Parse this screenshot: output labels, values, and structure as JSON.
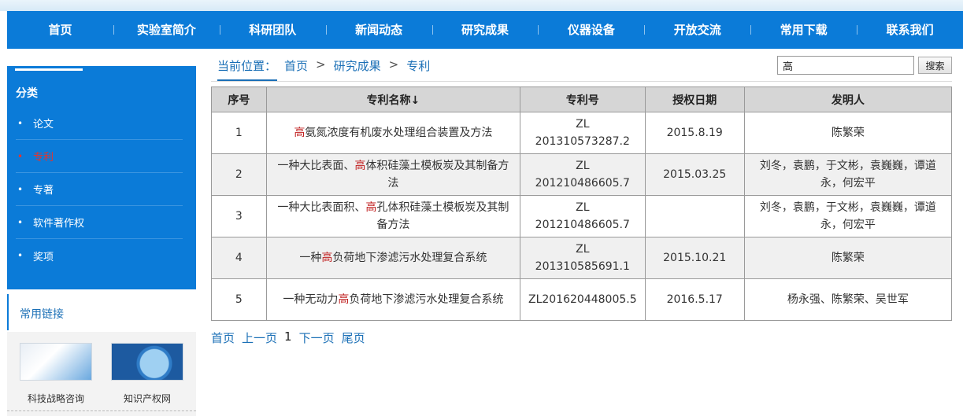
{
  "nav": [
    "首页",
    "实验室简介",
    "科研团队",
    "新闻动态",
    "研究成果",
    "仪器设备",
    "开放交流",
    "常用下载",
    "联系我们"
  ],
  "sidebar": {
    "title": "分类",
    "items": [
      {
        "label": "论文",
        "active": false
      },
      {
        "label": "专利",
        "active": true
      },
      {
        "label": "专著",
        "active": false
      },
      {
        "label": "软件著作权",
        "active": false
      },
      {
        "label": "奖项",
        "active": false
      }
    ]
  },
  "links": {
    "title": "常用链接",
    "items": [
      "科技战略咨询",
      "知识产权网"
    ]
  },
  "breadcrumb": {
    "prefix": "当前位置：",
    "home": "首页",
    "sep": ">",
    "section": "研究成果",
    "current": "专利"
  },
  "search": {
    "value": "高",
    "button": "搜索"
  },
  "table": {
    "headers": [
      "序号",
      "专利名称↓",
      "专利号",
      "授权日期",
      "发明人"
    ],
    "rows": [
      {
        "no": "1",
        "name_pre": "",
        "name_hl": "高",
        "name_post": "氨氮浓度有机废水处理组合装置及方法",
        "number": "ZL 201310573287.2",
        "date": "2015.8.19",
        "inventors": "陈繁荣"
      },
      {
        "no": "2",
        "name_pre": "一种大比表面、",
        "name_hl": "高",
        "name_post": "体积硅藻土模板炭及其制备方法",
        "number": "ZL 201210486605.7",
        "date": "2015.03.25",
        "inventors": "刘冬，袁鹏，于文彬，袁巍巍，谭道永，何宏平"
      },
      {
        "no": "3",
        "name_pre": "一种大比表面积、",
        "name_hl": "高",
        "name_post": "孔体积硅藻土模板炭及其制备方法",
        "number": "ZL 201210486605.7",
        "date": "",
        "inventors": "刘冬，袁鹏，于文彬，袁巍巍，谭道永，何宏平"
      },
      {
        "no": "4",
        "name_pre": "一种",
        "name_hl": "高",
        "name_post": "负荷地下渗滤污水处理复合系统",
        "number": "ZL 201310585691.1",
        "date": "2015.10.21",
        "inventors": "陈繁荣"
      },
      {
        "no": "5",
        "name_pre": "一种无动力",
        "name_hl": "高",
        "name_post": "负荷地下渗滤污水处理复合系统",
        "number": "ZL201620448005.5",
        "date": "2016.5.17",
        "inventors": "杨永强、陈繁荣、吴世军"
      }
    ]
  },
  "pager": {
    "first": "首页",
    "prev": "上一页",
    "current": "1",
    "next": "下一页",
    "last": "尾页"
  },
  "colors": {
    "primary": "#0b7bd8",
    "link": "#1a6fb6",
    "highlight": "#c02020",
    "active_side": "#e8322a"
  }
}
